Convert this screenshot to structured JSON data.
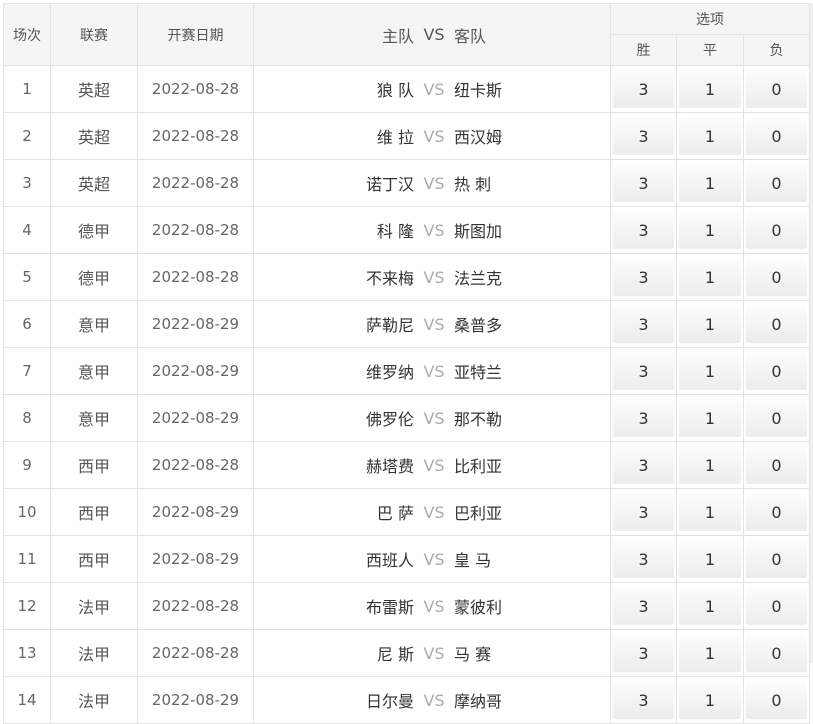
{
  "header": {
    "num_label": "场次",
    "league_label": "联赛",
    "date_label": "开赛日期",
    "home_label": "主队",
    "vs_label": "VS",
    "away_label": "客队",
    "options_label": "选项",
    "win_label": "胜",
    "draw_label": "平",
    "loss_label": "负"
  },
  "rows": [
    {
      "num": "1",
      "league": "英超",
      "date": "2022-08-28",
      "home": "狼 队",
      "vs": "VS",
      "away": "纽卡斯",
      "win": "3",
      "draw": "1",
      "loss": "0"
    },
    {
      "num": "2",
      "league": "英超",
      "date": "2022-08-28",
      "home": "维 拉",
      "vs": "VS",
      "away": "西汉姆",
      "win": "3",
      "draw": "1",
      "loss": "0"
    },
    {
      "num": "3",
      "league": "英超",
      "date": "2022-08-28",
      "home": "诺丁汉",
      "vs": "VS",
      "away": "热 刺",
      "win": "3",
      "draw": "1",
      "loss": "0"
    },
    {
      "num": "4",
      "league": "德甲",
      "date": "2022-08-28",
      "home": "科 隆",
      "vs": "VS",
      "away": "斯图加",
      "win": "3",
      "draw": "1",
      "loss": "0"
    },
    {
      "num": "5",
      "league": "德甲",
      "date": "2022-08-28",
      "home": "不来梅",
      "vs": "VS",
      "away": "法兰克",
      "win": "3",
      "draw": "1",
      "loss": "0"
    },
    {
      "num": "6",
      "league": "意甲",
      "date": "2022-08-29",
      "home": "萨勒尼",
      "vs": "VS",
      "away": "桑普多",
      "win": "3",
      "draw": "1",
      "loss": "0"
    },
    {
      "num": "7",
      "league": "意甲",
      "date": "2022-08-29",
      "home": "维罗纳",
      "vs": "VS",
      "away": "亚特兰",
      "win": "3",
      "draw": "1",
      "loss": "0"
    },
    {
      "num": "8",
      "league": "意甲",
      "date": "2022-08-29",
      "home": "佛罗伦",
      "vs": "VS",
      "away": "那不勒",
      "win": "3",
      "draw": "1",
      "loss": "0"
    },
    {
      "num": "9",
      "league": "西甲",
      "date": "2022-08-28",
      "home": "赫塔费",
      "vs": "VS",
      "away": "比利亚",
      "win": "3",
      "draw": "1",
      "loss": "0"
    },
    {
      "num": "10",
      "league": "西甲",
      "date": "2022-08-29",
      "home": "巴 萨",
      "vs": "VS",
      "away": "巴利亚",
      "win": "3",
      "draw": "1",
      "loss": "0"
    },
    {
      "num": "11",
      "league": "西甲",
      "date": "2022-08-29",
      "home": "西班人",
      "vs": "VS",
      "away": "皇 马",
      "win": "3",
      "draw": "1",
      "loss": "0"
    },
    {
      "num": "12",
      "league": "法甲",
      "date": "2022-08-28",
      "home": "布雷斯",
      "vs": "VS",
      "away": "蒙彼利",
      "win": "3",
      "draw": "1",
      "loss": "0"
    },
    {
      "num": "13",
      "league": "法甲",
      "date": "2022-08-28",
      "home": "尼 斯",
      "vs": "VS",
      "away": "马 赛",
      "win": "3",
      "draw": "1",
      "loss": "0"
    },
    {
      "num": "14",
      "league": "法甲",
      "date": "2022-08-29",
      "home": "日尔曼",
      "vs": "VS",
      "away": "摩纳哥",
      "win": "3",
      "draw": "1",
      "loss": "0"
    }
  ]
}
